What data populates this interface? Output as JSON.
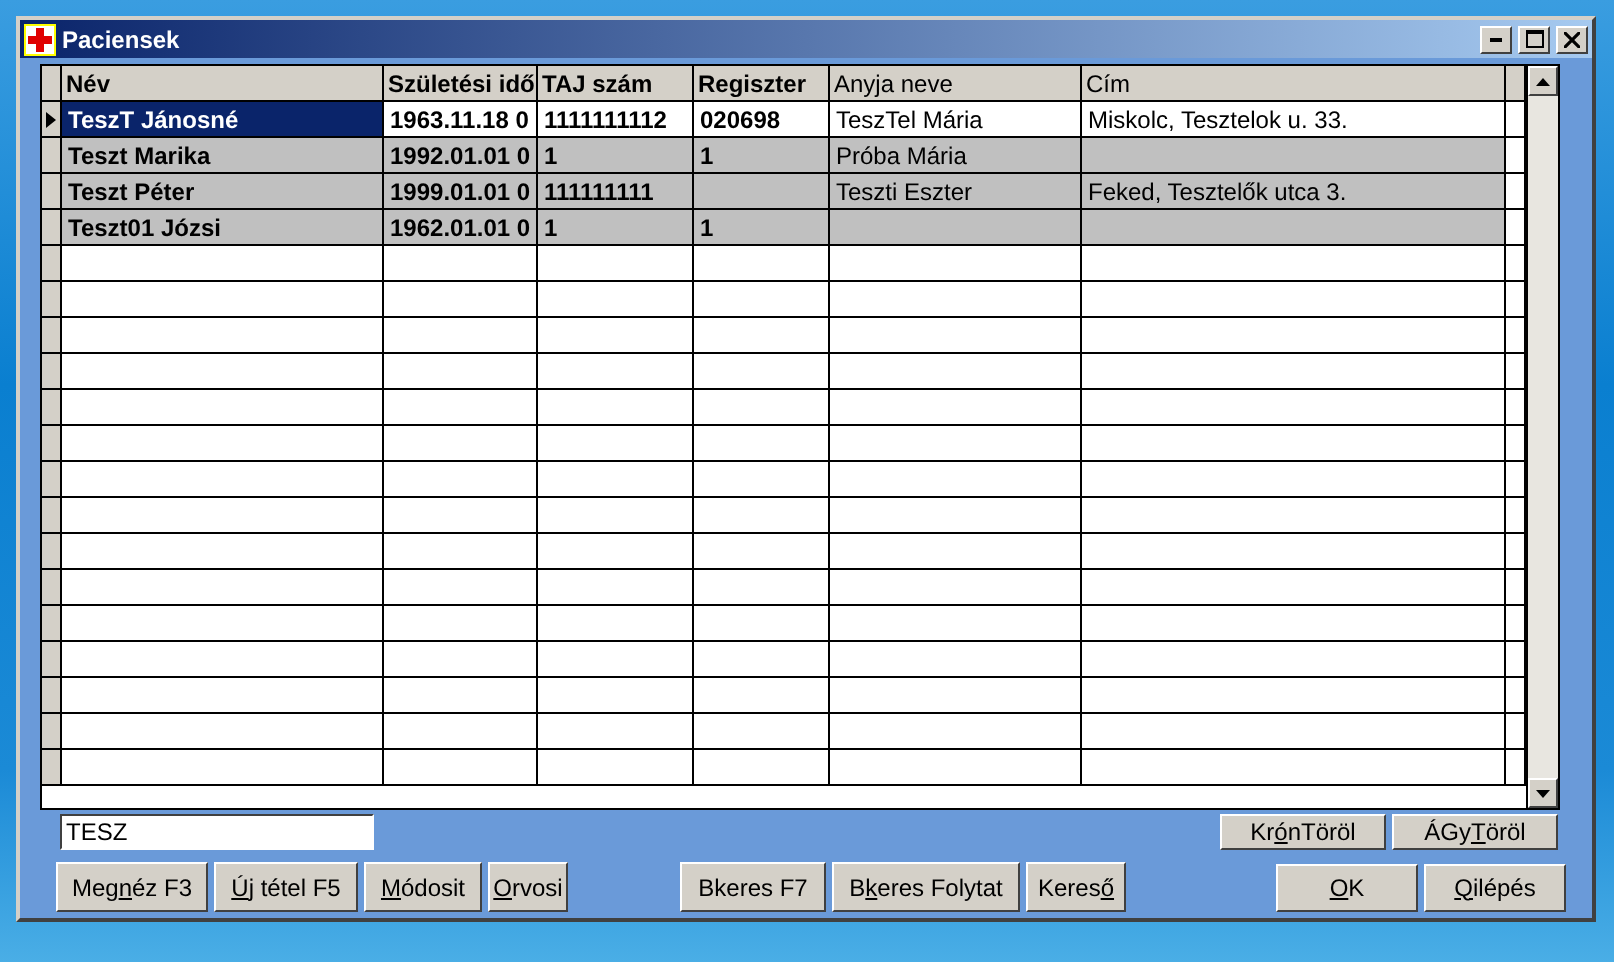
{
  "window": {
    "title": "Paciensek"
  },
  "table": {
    "columns": [
      "Név",
      "Születési idő",
      "TAJ szám",
      "Regiszter",
      "Anyja neve",
      "Cím"
    ],
    "rows": [
      {
        "selected": true,
        "cells": [
          "TeszT Jánosné",
          "1963.11.18 0",
          "1111111112",
          "020698",
          "TeszTel Mária",
          "Miskolc,   Tesztelok u. 33."
        ]
      },
      {
        "selected": false,
        "cells": [
          "Teszt Marika",
          "1992.01.01 0",
          "1",
          "1",
          "Próba Mária",
          ""
        ]
      },
      {
        "selected": false,
        "cells": [
          "Teszt Péter",
          "1999.01.01 0",
          "111111111",
          "",
          "Teszti Eszter",
          "Feked,   Tesztelők utca 3."
        ]
      },
      {
        "selected": false,
        "cells": [
          "Teszt01 Józsi",
          "1962.01.01 0",
          "1",
          "1",
          "",
          ""
        ]
      }
    ]
  },
  "search": {
    "value": "TESZ"
  },
  "delete_buttons": [
    {
      "before": "Kr",
      "key": "ó",
      "after": "nTöröl"
    },
    {
      "before": "ÁGy",
      "key": "T",
      "after": "öröl"
    }
  ],
  "button_groups": [
    [
      {
        "before": "Meg",
        "key": "n",
        "after": "éz F3"
      },
      {
        "key": "Ú",
        "after": "j tétel F5"
      },
      {
        "key": "M",
        "after": "ódosit"
      },
      {
        "key": "O",
        "after": "rvosi"
      }
    ],
    [
      {
        "before": "Bkeres F7"
      },
      {
        "before": "B",
        "key": "k",
        "after": "eres Folytat"
      },
      {
        "before": "Keres",
        "key": "ő"
      }
    ],
    [
      {
        "key": "O",
        "after": "K"
      },
      {
        "key": "Q",
        "after": "ilépés"
      }
    ]
  ]
}
